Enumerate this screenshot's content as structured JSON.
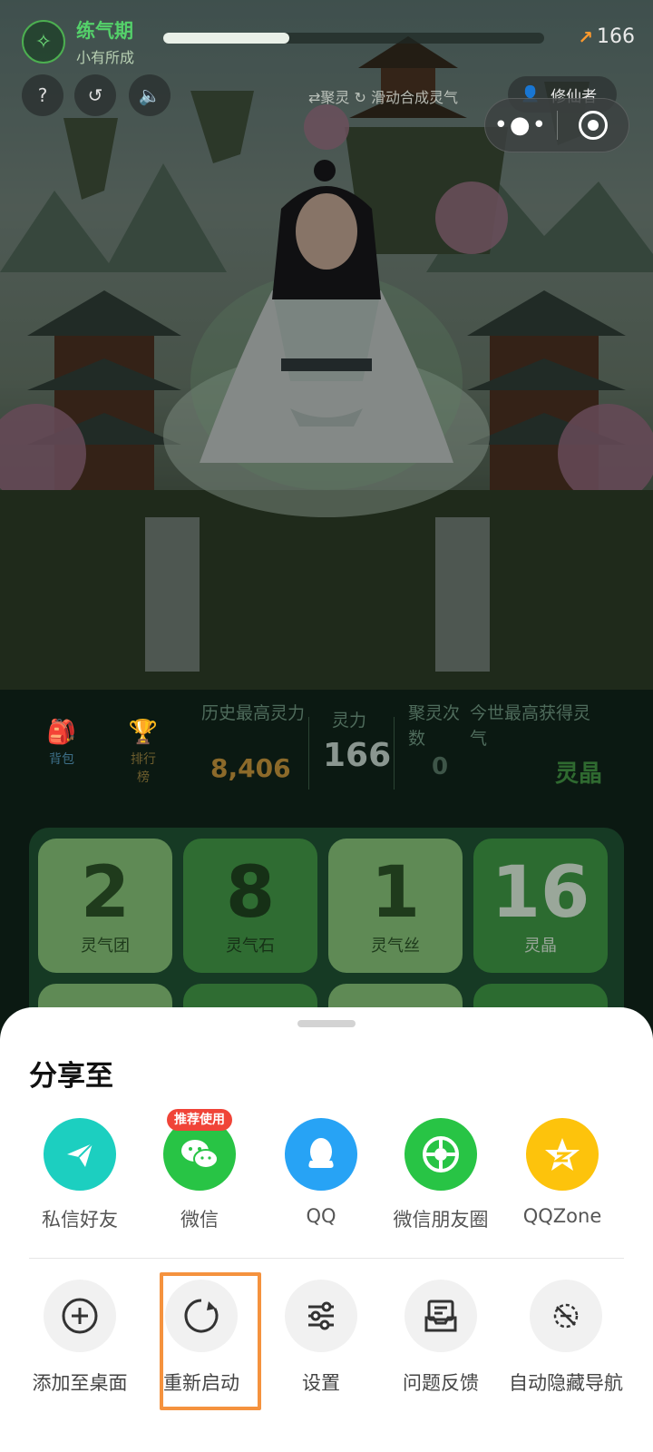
{
  "hud": {
    "realm": "练气期",
    "realm_sub": "小有所成",
    "progress": 0.33,
    "power": "166",
    "hint": "⇄聚灵 ↻ 滑动合成灵气",
    "user": "修仙者"
  },
  "stats": {
    "tabs": [
      {
        "icon": "backpack-icon",
        "label": "背包"
      },
      {
        "icon": "trophy-icon",
        "label": "排行榜"
      }
    ],
    "best_power_label": "历史最高灵力",
    "best_power_value": "8,406",
    "power_label": "灵力",
    "power_value": "166",
    "gather_label": "聚灵次数",
    "gather_value": "0",
    "today_label": "今世最高获得灵气",
    "today_value": "灵晶"
  },
  "tiles": [
    {
      "num": "2",
      "name": "灵气团"
    },
    {
      "num": "8",
      "name": "灵气石"
    },
    {
      "num": "1",
      "name": "灵气丝"
    },
    {
      "num": "16",
      "name": "灵晶"
    }
  ],
  "sheet": {
    "title": "分享至",
    "badge": "推荐使用",
    "share": [
      {
        "label": "私信好友",
        "icon": "paper-plane-icon",
        "color": "#1ccfc0"
      },
      {
        "label": "微信",
        "icon": "wechat-icon",
        "color": "#28c445"
      },
      {
        "label": "QQ",
        "icon": "qq-penguin-icon",
        "color": "#27a3f5"
      },
      {
        "label": "微信朋友圈",
        "icon": "moments-icon",
        "color": "#28c445"
      },
      {
        "label": "QQZone",
        "icon": "qzone-star-icon",
        "color": "#fdc30c"
      }
    ],
    "actions": [
      {
        "label": "添加至桌面",
        "icon": "add-circle-icon"
      },
      {
        "label": "重新启动",
        "icon": "restart-icon"
      },
      {
        "label": "设置",
        "icon": "settings-sliders-icon"
      },
      {
        "label": "问题反馈",
        "icon": "feedback-inbox-icon"
      },
      {
        "label": "自动隐藏导航",
        "icon": "hide-nav-icon"
      }
    ]
  }
}
